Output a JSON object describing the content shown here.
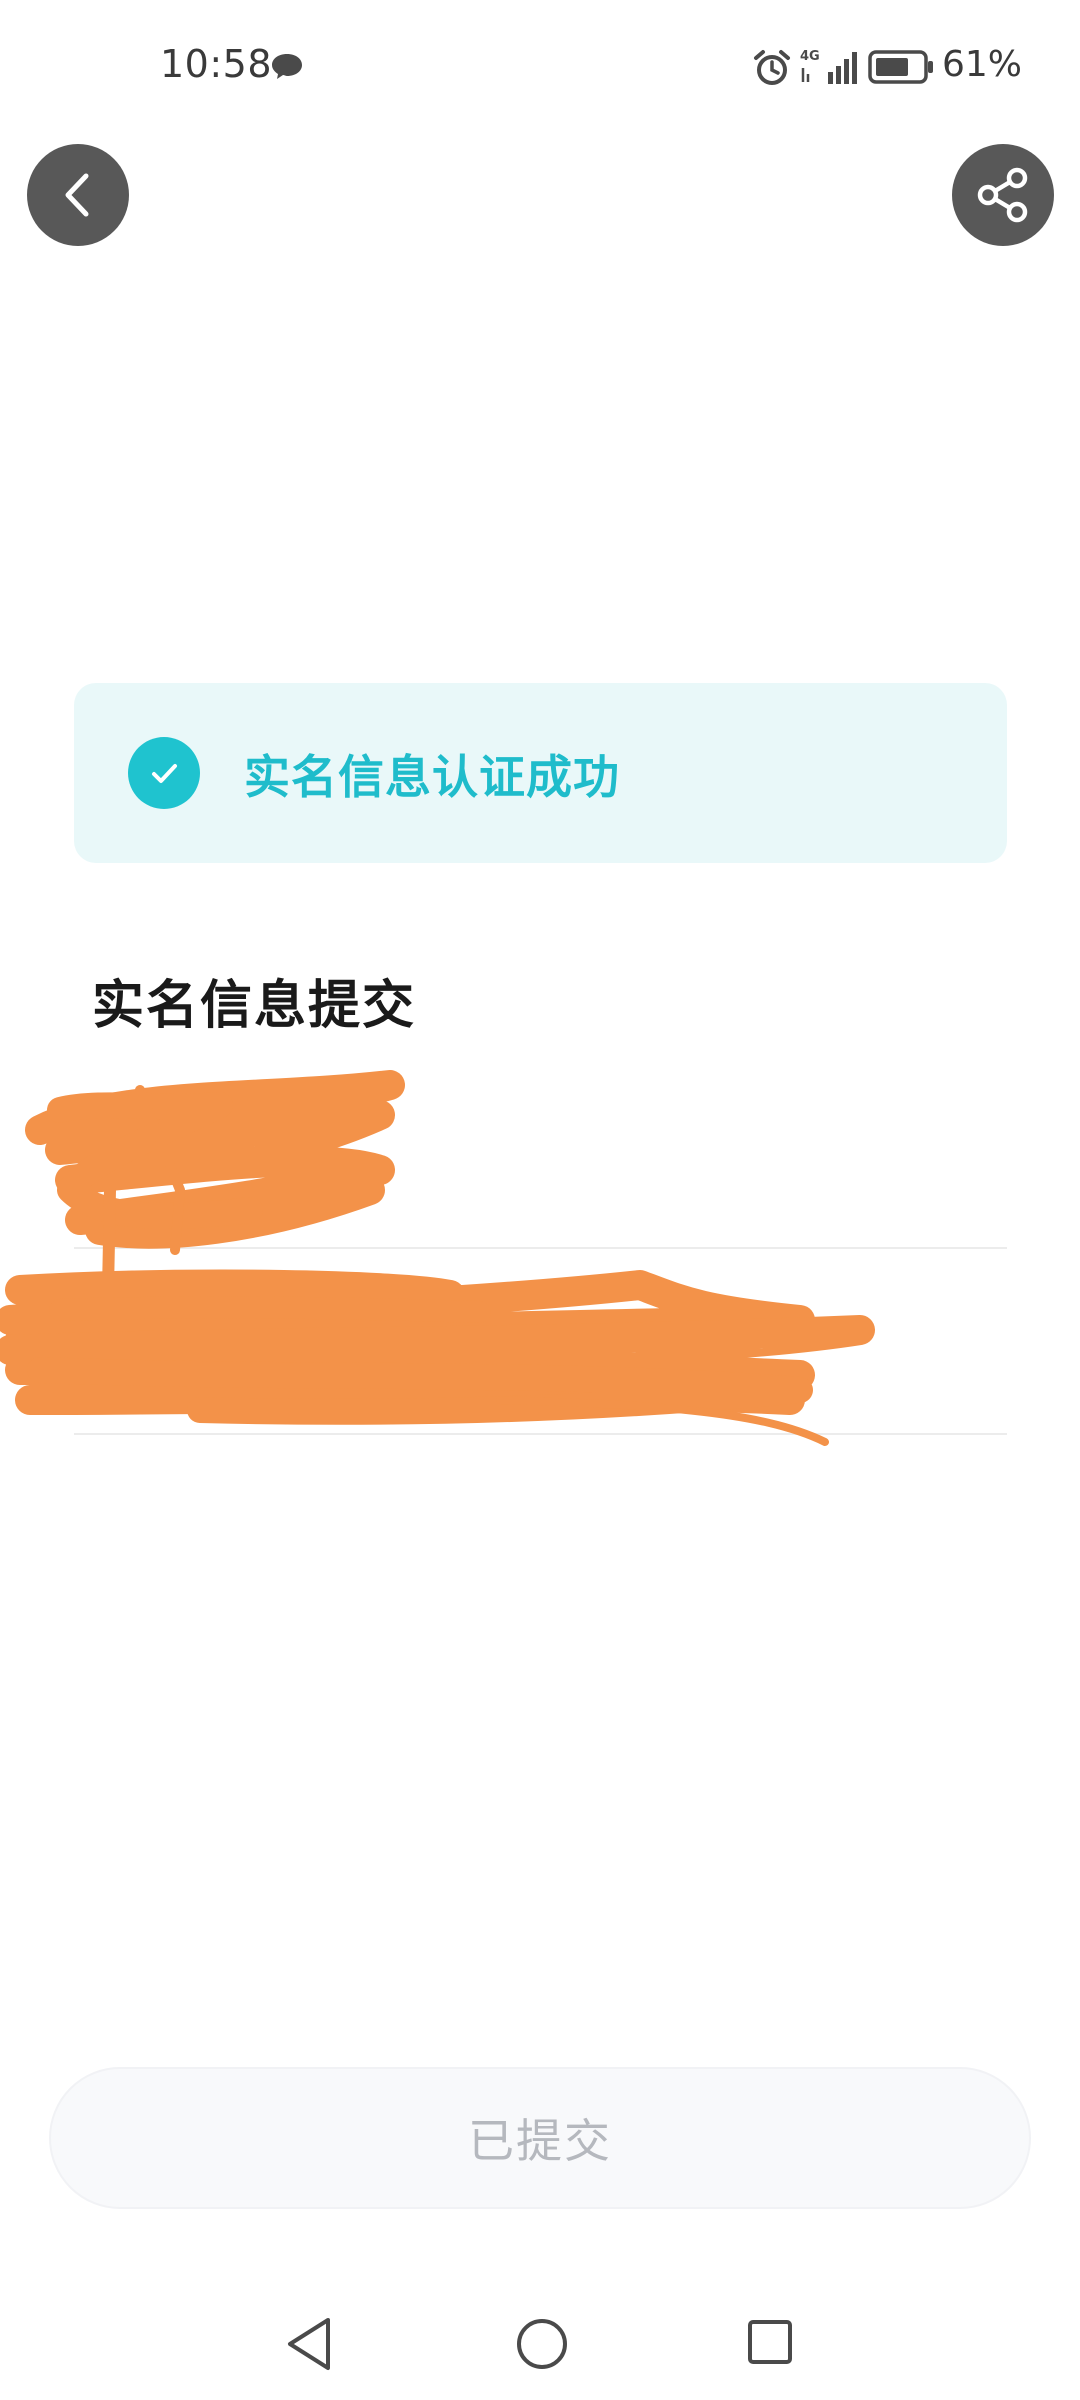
{
  "status_bar": {
    "time": "10:58",
    "battery": "61%",
    "network": "4G"
  },
  "header": {
    "back_icon": "chevron-left-icon",
    "share_icon": "share-icon"
  },
  "banner": {
    "icon": "check-circle-icon",
    "text": "实名信息认证成功",
    "accent_color": "#1fc3cf"
  },
  "section": {
    "title": "实名信息提交"
  },
  "submit": {
    "label": "已提交"
  },
  "nav": {
    "back_icon": "triangle-back-icon",
    "home_icon": "circle-home-icon",
    "recent_icon": "square-recent-icon"
  }
}
